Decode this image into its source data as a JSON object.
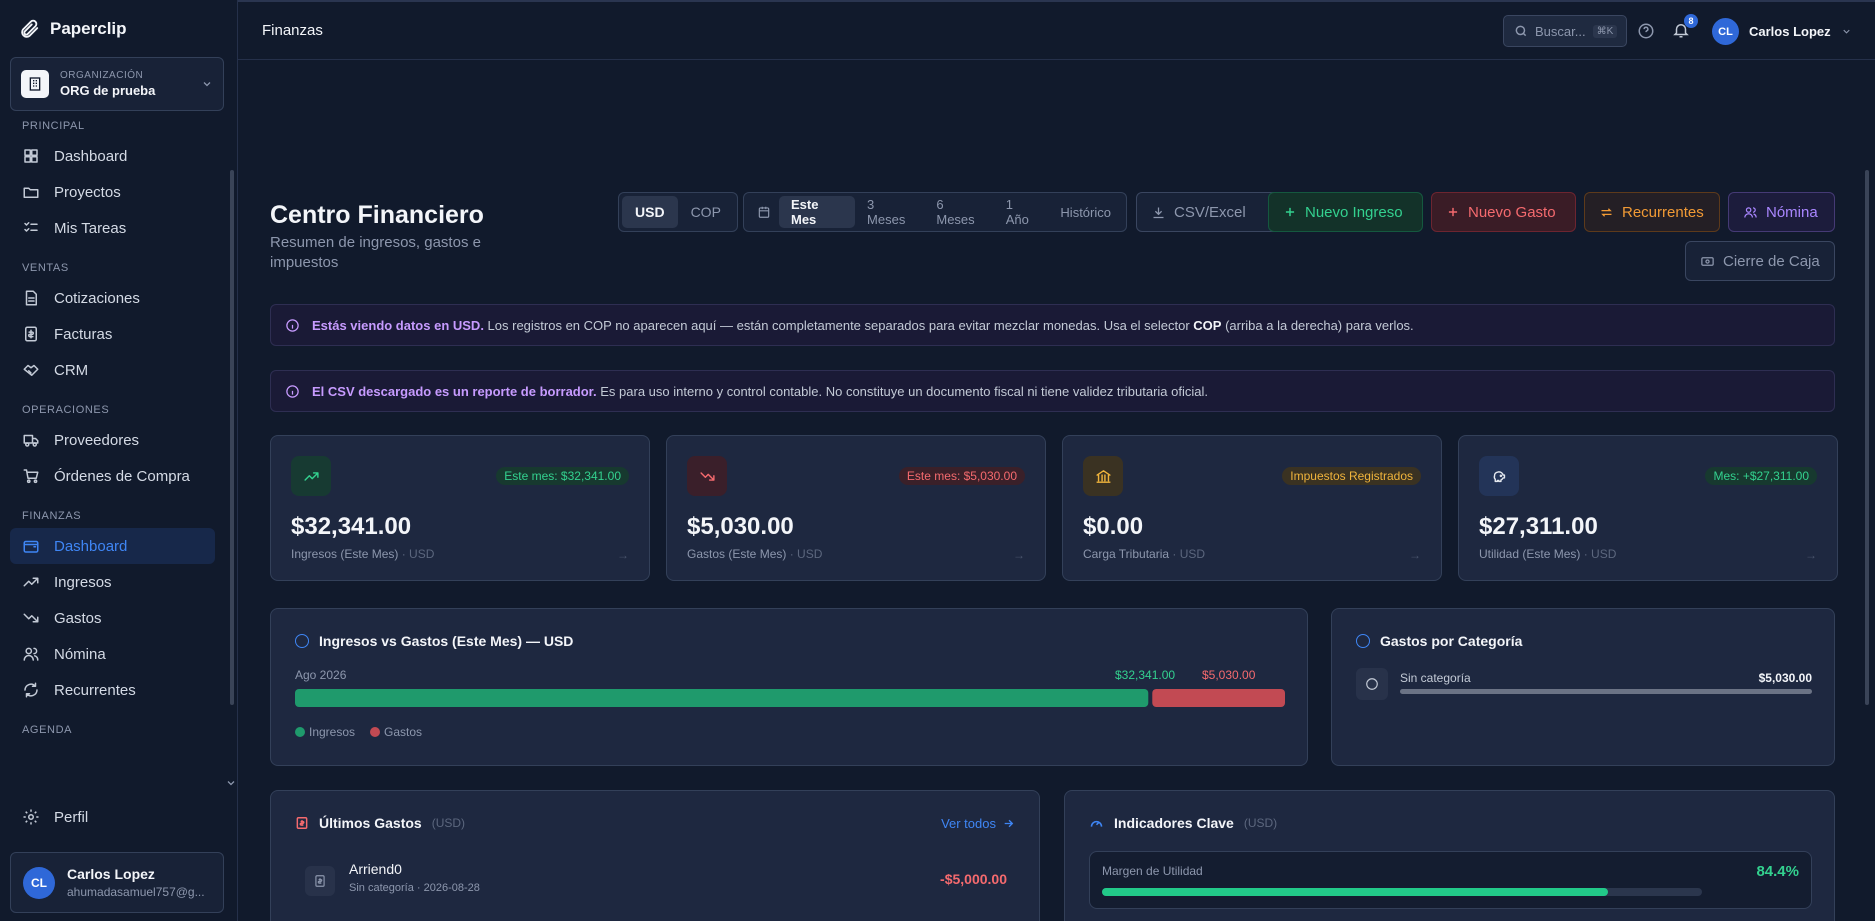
{
  "app": {
    "name": "Paperclip"
  },
  "org": {
    "label": "ORGANIZACIÓN",
    "name": "ORG de prueba"
  },
  "sidebar": {
    "sections": [
      {
        "title": "PRINCIPAL",
        "items": [
          {
            "label": "Dashboard",
            "icon": "layout-grid-icon"
          },
          {
            "label": "Proyectos",
            "icon": "folder-icon"
          },
          {
            "label": "Mis Tareas",
            "icon": "list-checks-icon"
          }
        ]
      },
      {
        "title": "VENTAS",
        "items": [
          {
            "label": "Cotizaciones",
            "icon": "file-text-icon"
          },
          {
            "label": "Facturas",
            "icon": "receipt-icon"
          },
          {
            "label": "CRM",
            "icon": "handshake-icon"
          }
        ]
      },
      {
        "title": "OPERACIONES",
        "items": [
          {
            "label": "Proveedores",
            "icon": "truck-icon"
          },
          {
            "label": "Órdenes de Compra",
            "icon": "cart-icon"
          }
        ]
      },
      {
        "title": "FINANZAS",
        "items": [
          {
            "label": "Dashboard",
            "icon": "wallet-icon",
            "active": true
          },
          {
            "label": "Ingresos",
            "icon": "trending-up-icon"
          },
          {
            "label": "Gastos",
            "icon": "trending-down-icon"
          },
          {
            "label": "Nómina",
            "icon": "users-icon"
          },
          {
            "label": "Recurrentes",
            "icon": "refresh-icon"
          }
        ]
      },
      {
        "title": "AGENDA",
        "items": []
      }
    ],
    "profile": "Perfil",
    "user": {
      "initials": "CL",
      "name": "Carlos Lopez",
      "email": "ahumadasamuel757@g..."
    }
  },
  "topbar": {
    "title": "Finanzas",
    "search_placeholder": "Buscar...",
    "search_shortcut": "⌘K",
    "notifications": "8",
    "user_initials": "CL",
    "user_name": "Carlos Lopez"
  },
  "page": {
    "title": "Centro Financiero",
    "subtitle": "Resumen de ingresos, gastos e impuestos",
    "currencies": [
      "USD",
      "COP"
    ],
    "currency_selected": "USD",
    "periods": [
      "Este Mes",
      "3 Meses",
      "6 Meses",
      "1 Año",
      "Histórico"
    ],
    "period_selected": "Este Mes",
    "buttons": {
      "csv": "CSV/Excel",
      "ingreso": "Nuevo Ingreso",
      "gasto": "Nuevo Gasto",
      "recurrentes": "Recurrentes",
      "nomina": "Nómina",
      "cierre": "Cierre de Caja"
    }
  },
  "notices": {
    "usd_bold": "Estás viendo datos en USD.",
    "usd_text1": " Los registros en COP no aparecen aquí — están completamente separados para evitar mezclar monedas. Usa el selector ",
    "usd_hl": "COP",
    "usd_text2": " (arriba a la derecha) para verlos.",
    "csv_bold": "El CSV descargado es un reporte de borrador.",
    "csv_text": " Es para uso interno y control contable. No constituye un documento fiscal ni tiene validez tributaria oficial."
  },
  "stats": [
    {
      "pill": "Este mes: $32,341.00",
      "value": "$32,341.00",
      "label": "Ingresos (Este Mes)",
      "unit": "· USD",
      "icon": "trending-up-icon",
      "color": "#33d18f"
    },
    {
      "pill": "Este mes: $5,030.00",
      "value": "$5,030.00",
      "label": "Gastos (Este Mes)",
      "unit": "· USD",
      "icon": "trending-down-icon",
      "color": "#f56a6e"
    },
    {
      "pill": "Impuestos Registrados",
      "value": "$0.00",
      "label": "Carga Tributaria",
      "unit": "· USD",
      "icon": "bank-icon",
      "color": "#f0b43c"
    },
    {
      "pill": "Mes: +$27,311.00",
      "value": "$27,311.00",
      "label": "Utilidad (Este Mes)",
      "unit": "· USD",
      "icon": "piggy-bank-icon",
      "color": "#33d18f"
    }
  ],
  "chart_data": {
    "type": "bar",
    "title": "Ingresos vs Gastos (Este Mes) — USD",
    "categories": [
      "Ago 2026"
    ],
    "series": [
      {
        "name": "Ingresos",
        "values": [
          32341.0
        ],
        "label": "$32,341.00",
        "color": "#1f9a6c"
      },
      {
        "name": "Gastos",
        "values": [
          5030.0
        ],
        "label": "$5,030.00",
        "color": "#c24a53"
      }
    ],
    "legend": "bottom-left"
  },
  "categories_panel": {
    "title": "Gastos por Categoría",
    "items": [
      {
        "name": "Sin categoría",
        "amount": "$5,030.00",
        "share": 1.0
      }
    ]
  },
  "latest_expenses": {
    "title": "Últimos Gastos",
    "unit": "(USD)",
    "view_all": "Ver todos",
    "items": [
      {
        "name": "Arriend0",
        "meta": "Sin categoría · 2026-08-28",
        "amount": "-$5,000.00"
      }
    ]
  },
  "kpis": {
    "title": "Indicadores Clave",
    "unit": "(USD)",
    "items": [
      {
        "label": "Margen de Utilidad",
        "value": "84.4%",
        "fraction": 0.844
      }
    ]
  }
}
